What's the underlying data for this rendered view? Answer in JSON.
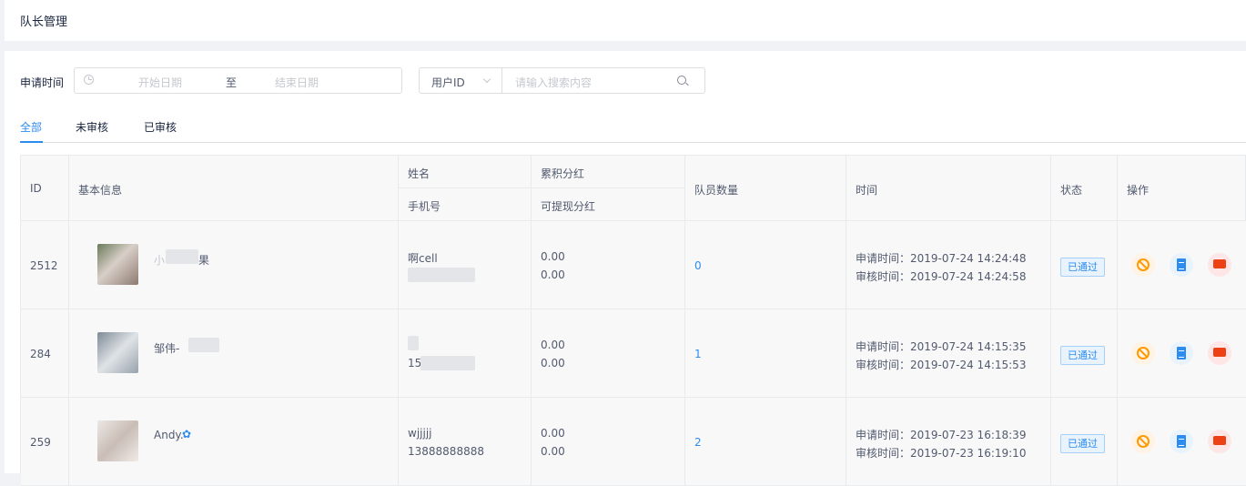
{
  "header": {
    "title": "队长管理"
  },
  "filter": {
    "date_label": "申请时间",
    "start_placeholder": "开始日期",
    "separator": "至",
    "end_placeholder": "结束日期",
    "search_field": "用户ID",
    "search_placeholder": "请输入搜索内容"
  },
  "tabs": [
    {
      "label": "全部",
      "active": true
    },
    {
      "label": "未审核",
      "active": false
    },
    {
      "label": "已审核",
      "active": false
    }
  ],
  "table": {
    "headers": {
      "id": "ID",
      "basic_info": "基本信息",
      "name": "姓名",
      "phone": "手机号",
      "total_dividend": "累积分红",
      "withdrawable_dividend": "可提现分红",
      "member_count": "队员数量",
      "time": "时间",
      "status": "状态",
      "actions": "操作"
    },
    "rows": [
      {
        "id": "2512",
        "nickname": "果",
        "nickname_prefix": "小",
        "name": "啊cell",
        "phone": "",
        "total": "0.00",
        "withdrawable": "0.00",
        "members": "0",
        "apply_time": "申请时间：2019-07-24 14:24:48",
        "review_time": "审核时间：2019-07-24 14:24:58",
        "status": "已通过",
        "avatar_color": "#b9a7a0"
      },
      {
        "id": "284",
        "nickname": "",
        "nickname_prefix": "邹伟-",
        "name": "",
        "phone": "15",
        "total": "0.00",
        "withdrawable": "0.00",
        "members": "1",
        "apply_time": "申请时间：2019-07-24 14:15:35",
        "review_time": "审核时间：2019-07-24 14:15:53",
        "status": "已通过",
        "avatar_color": "#a8b4bf"
      },
      {
        "id": "259",
        "nickname": "",
        "nickname_prefix": "Andy.",
        "name": "wjjjjj",
        "phone": "13888888888",
        "total": "0.00",
        "withdrawable": "0.00",
        "members": "2",
        "apply_time": "申请时间：2019-07-23 16:18:39",
        "review_time": "审核时间：2019-07-23 16:19:10",
        "status": "已通过",
        "avatar_color": "#d6cfcb"
      }
    ]
  },
  "colors": {
    "accent": "#2d8cf0",
    "ban": "#ff9900",
    "message": "#ed4014"
  },
  "icons": {
    "date": "clock-icon",
    "search": "search-icon",
    "select": "chevron-down-icon",
    "ban": "ban-icon",
    "detail": "document-icon",
    "message": "message-icon"
  }
}
